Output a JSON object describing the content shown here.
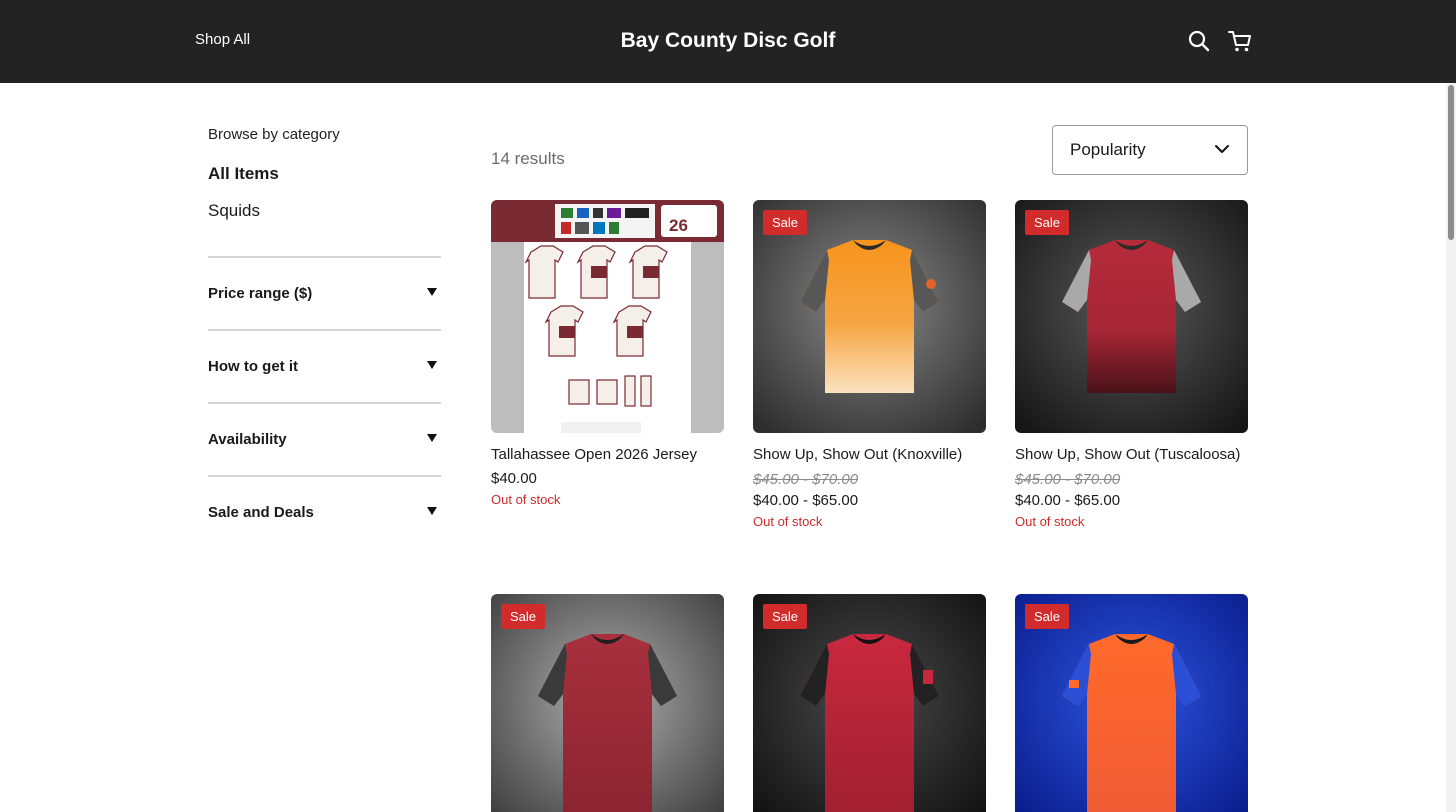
{
  "header": {
    "nav_label": "Shop All",
    "site_title": "Bay County Disc Golf",
    "icons": [
      "search-icon",
      "cart-icon"
    ]
  },
  "sidebar": {
    "browse_label": "Browse by category",
    "categories": [
      {
        "label": "All Items",
        "selected": true
      },
      {
        "label": "Squids",
        "selected": false
      }
    ],
    "filters": [
      {
        "label": "Price range ($)"
      },
      {
        "label": "How to get it"
      },
      {
        "label": "Availability"
      },
      {
        "label": "Sale and Deals"
      }
    ]
  },
  "main": {
    "results_count": "14 results",
    "sort": {
      "selected": "Popularity"
    },
    "products": [
      {
        "name": "Tallahassee Open 2026 Jersey",
        "sale": false,
        "original_price": "",
        "price": "$40.00",
        "stock": "Out of stock",
        "image": "jersey-collage-maroon"
      },
      {
        "name": "Show Up, Show Out (Knoxville)",
        "sale": true,
        "badge": "Sale",
        "original_price": "$45.00 - $70.00",
        "price": "$40.00 - $65.00",
        "stock": "Out of stock",
        "image": "jersey-orange-gray-sleeves"
      },
      {
        "name": "Show Up, Show Out (Tuscaloosa)",
        "sale": true,
        "badge": "Sale",
        "original_price": "$45.00 - $70.00",
        "price": "$40.00 - $65.00",
        "stock": "Out of stock",
        "image": "jersey-crimson-gray-sleeves"
      },
      {
        "name": "",
        "sale": true,
        "badge": "Sale",
        "image": "jersey-maroon-dark-sleeves"
      },
      {
        "name": "",
        "sale": true,
        "badge": "Sale",
        "image": "jersey-red-black-sleeves"
      },
      {
        "name": "",
        "sale": true,
        "badge": "Sale",
        "image": "jersey-orange-blue-sleeves"
      }
    ]
  },
  "colors": {
    "header_bg": "#232323",
    "sale_badge": "#d22b2b",
    "out_of_stock": "#cc2b2b"
  }
}
